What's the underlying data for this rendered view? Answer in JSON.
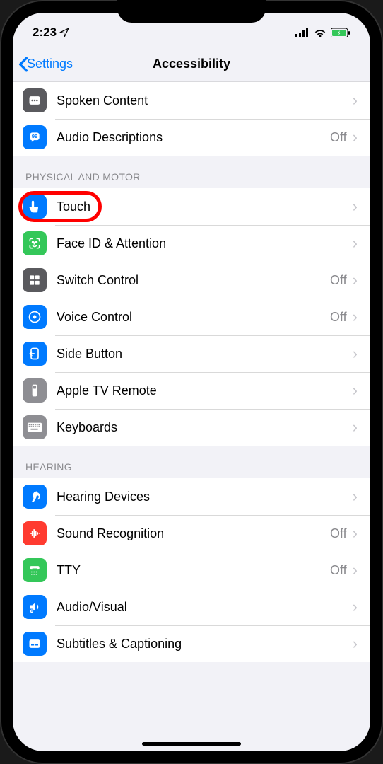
{
  "status": {
    "time": "2:23"
  },
  "nav": {
    "back_label": "Settings",
    "title": "Accessibility"
  },
  "sections": {
    "top": {
      "spoken_content": {
        "label": "Spoken Content",
        "value": ""
      },
      "audio_descriptions": {
        "label": "Audio Descriptions",
        "value": "Off"
      }
    },
    "physical": {
      "header": "Physical and Motor",
      "touch": {
        "label": "Touch",
        "value": ""
      },
      "face_id": {
        "label": "Face ID & Attention",
        "value": ""
      },
      "switch_control": {
        "label": "Switch Control",
        "value": "Off"
      },
      "voice_control": {
        "label": "Voice Control",
        "value": "Off"
      },
      "side_button": {
        "label": "Side Button",
        "value": ""
      },
      "apple_tv": {
        "label": "Apple TV Remote",
        "value": ""
      },
      "keyboards": {
        "label": "Keyboards",
        "value": ""
      }
    },
    "hearing": {
      "header": "Hearing",
      "hearing_devices": {
        "label": "Hearing Devices",
        "value": ""
      },
      "sound_recognition": {
        "label": "Sound Recognition",
        "value": "Off"
      },
      "tty": {
        "label": "TTY",
        "value": "Off"
      },
      "audio_visual": {
        "label": "Audio/Visual",
        "value": ""
      },
      "subtitles": {
        "label": "Subtitles & Captioning",
        "value": ""
      }
    }
  }
}
